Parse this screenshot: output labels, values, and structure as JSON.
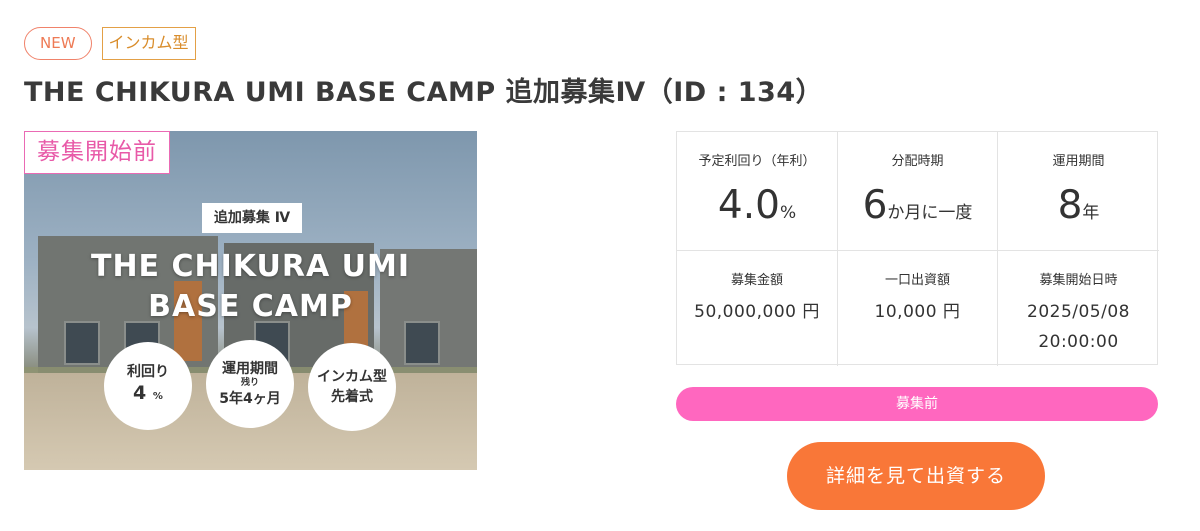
{
  "badges": {
    "new": "NEW",
    "type": "インカム型"
  },
  "title": "THE CHIKURA UMI BASE CAMP 追加募集Ⅳ（ID : 134）",
  "hero": {
    "status_stamp": "募集開始前",
    "tag": "追加募集 Ⅳ",
    "name_line1": "THE CHIKURA UMI",
    "name_line2": "BASE CAMP",
    "circle1": {
      "label": "利回り",
      "value": "4",
      "unit": "%"
    },
    "circle2": {
      "label": "運用期間",
      "sub": "残り",
      "value": "5年4ヶ月"
    },
    "circle3": {
      "line1": "インカム型",
      "line2": "先着式"
    }
  },
  "stats": {
    "yield": {
      "label": "予定利回り（年利）",
      "value": "4.0",
      "unit": "%"
    },
    "distribution": {
      "label": "分配時期",
      "value": "6",
      "unit": "か月に一度"
    },
    "period": {
      "label": "運用期間",
      "value": "8",
      "unit": "年"
    },
    "amount": {
      "label": "募集金額",
      "value": "50,000,000 円"
    },
    "unit_investment": {
      "label": "一口出資額",
      "value": "10,000 円"
    },
    "start": {
      "label": "募集開始日時",
      "date": "2025/05/08",
      "time": "20:00:00"
    }
  },
  "status_bar": "募集前",
  "cta": "詳細を見て出資する",
  "colors": {
    "status_pink": "#ff67bf",
    "cta_orange": "#f97738",
    "stamp_pink": "#e85aa8"
  }
}
